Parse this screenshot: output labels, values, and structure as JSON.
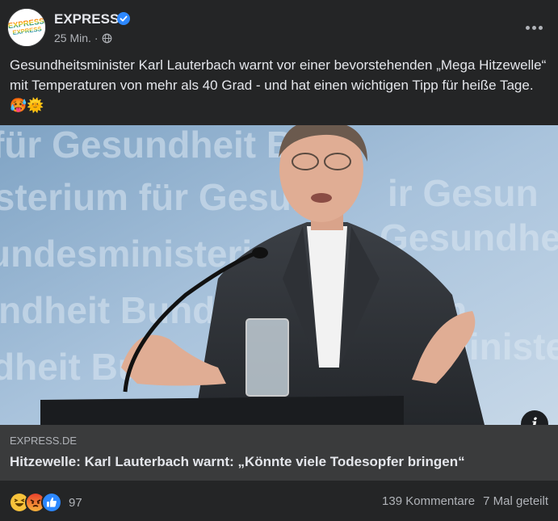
{
  "post": {
    "page_name": "EXPRESS",
    "timestamp": "25 Min.",
    "separator": "·",
    "text": "Gesundheitsminister Karl Lauterbach warnt vor einer bevorstehenden „Mega Hitzewelle“ mit Temperaturen von mehr als 40 Grad - und hat einen wichtigen Tipp für heiße Tage. 🥵🌞",
    "avatar_text": "EXPRESS",
    "icons": {
      "verified": "verified-badge-icon",
      "audience": "globe-icon",
      "more": "more-options-icon",
      "info": "info-icon"
    }
  },
  "photo": {
    "backdrop_text": [
      "für Gesundheit Bun",
      "isterium für Gesund",
      "undesministerium für",
      "undheit Bundesministerium",
      "dheit Bundes",
      "ir Gesun",
      "Gesundheit Bu",
      "ministerium"
    ]
  },
  "link_preview": {
    "domain": "EXPRESS.DE",
    "title": "Hitzewelle: Karl Lauterbach warnt: „Könnte viele Todesopfer bringen“",
    "info_label": "i"
  },
  "footer": {
    "reactions": [
      "haha",
      "angry",
      "like"
    ],
    "reaction_count": "97",
    "comments": "139 Kommentare",
    "shares": "7 Mal geteilt"
  },
  "colors": {
    "background": "#242526",
    "text_primary": "#e4e6eb",
    "text_secondary": "#b0b3b8",
    "link_box": "#3a3b3c",
    "verified": "#2d88ff"
  }
}
